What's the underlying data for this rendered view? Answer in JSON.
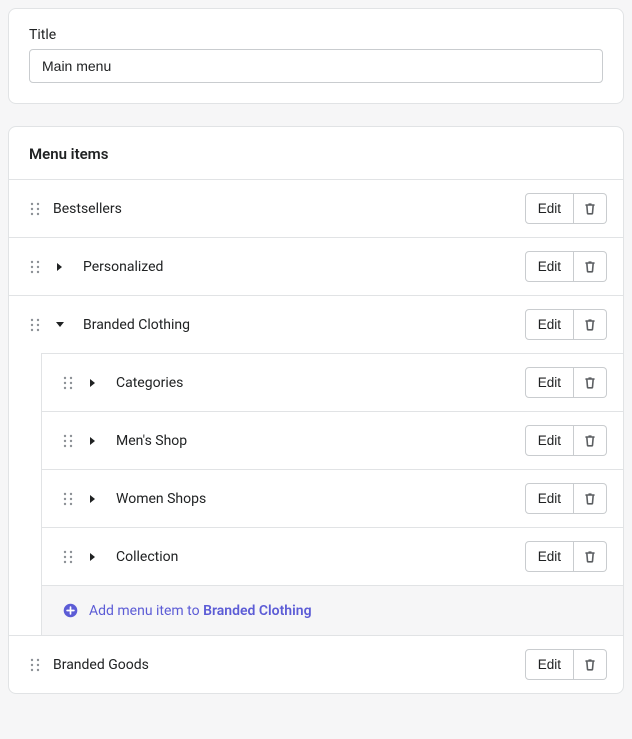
{
  "title_section": {
    "label": "Title",
    "value": "Main menu"
  },
  "menu_section": {
    "header": "Menu items",
    "edit_label": "Edit",
    "items": [
      {
        "label": "Bestsellers",
        "has_children": false,
        "expanded": false
      },
      {
        "label": "Personalized",
        "has_children": true,
        "expanded": false
      },
      {
        "label": "Branded Clothing",
        "has_children": true,
        "expanded": true
      },
      {
        "label": "Branded Goods",
        "has_children": false,
        "expanded": false
      }
    ],
    "branded_clothing_children": [
      {
        "label": "Categories",
        "has_children": true
      },
      {
        "label": "Men's Shop",
        "has_children": true
      },
      {
        "label": "Women Shops",
        "has_children": true
      },
      {
        "label": "Collection",
        "has_children": true
      }
    ],
    "add_item": {
      "prefix": "Add menu item to ",
      "target": "Branded Clothing"
    }
  }
}
